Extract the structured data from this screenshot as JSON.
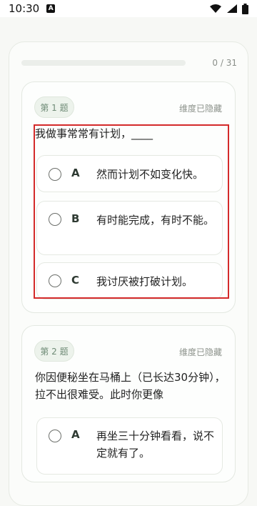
{
  "status_bar": {
    "time": "10:30",
    "sim_badge": "A",
    "icons": [
      "wifi-icon",
      "signal-icon",
      "battery-icon"
    ]
  },
  "progress": {
    "text": "0 / 31",
    "fraction": 0
  },
  "questions": [
    {
      "tag": "第 1 题",
      "dimension_label": "维度已隐藏",
      "text": "我做事常常有计划，____",
      "options": [
        {
          "letter": "A",
          "text": "然而计划不如变化快。"
        },
        {
          "letter": "B",
          "text": "有时能完成，有时不能。"
        },
        {
          "letter": "C",
          "text": "我讨厌被打破计划。"
        }
      ]
    },
    {
      "tag": "第 2 题",
      "dimension_label": "维度已隐藏",
      "text": "你因便秘坐在马桶上（已长达30分钟），拉不出很难受。此时你更像",
      "options": [
        {
          "letter": "A",
          "text": "再坐三十分钟看看，说不定就有了。"
        }
      ]
    }
  ],
  "colors": {
    "accent_green": "#8cb79a",
    "highlight_red": "#d42a2a"
  }
}
